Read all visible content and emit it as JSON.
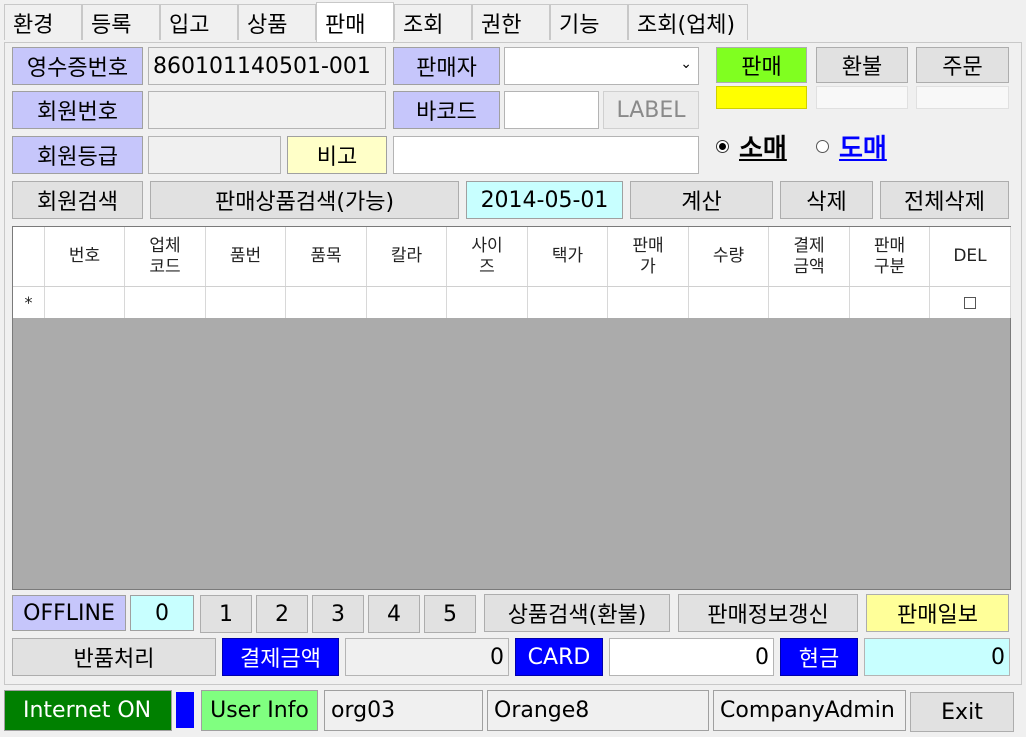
{
  "tabs": [
    "환경",
    "등록",
    "입고",
    "상품",
    "판매",
    "조회",
    "권한",
    "기능",
    "조회(업체)"
  ],
  "form": {
    "receipt_label": "영수증번호",
    "receipt_value": "860101140501-001",
    "seller_label": "판매자",
    "seller_value": "",
    "member_no_label": "회원번호",
    "member_no_value": "",
    "barcode_label": "바코드",
    "barcode_value": "",
    "label_button": "LABEL",
    "member_grade_label": "회원등급",
    "member_grade_value": "",
    "note_label": "비고",
    "note_value": ""
  },
  "mode": {
    "sale": "판매",
    "refund": "환불",
    "order": "주문"
  },
  "sale_type": {
    "retail": "소매",
    "wholesale": "도매",
    "selected": "retail"
  },
  "actions": {
    "member_search": "회원검색",
    "product_search": "판매상품검색(가능)",
    "date": "2014-05-01",
    "calculate": "계산",
    "delete": "삭제",
    "delete_all": "전체삭제"
  },
  "grid": {
    "columns": [
      "",
      "번호",
      "업체\n코드",
      "품번",
      "품목",
      "칼라",
      "사이\n즈",
      "택가",
      "판매\n가",
      "수량",
      "결제\n금액",
      "판매\n구분",
      "DEL"
    ],
    "new_row_marker": "*"
  },
  "bottom": {
    "offline": "OFFLINE",
    "count": "0",
    "pages": [
      "1",
      "2",
      "3",
      "4",
      "5"
    ],
    "refund_search": "상품검색(환불)",
    "refresh_sales": "판매정보갱신",
    "daily_report": "판매일보",
    "return_process": "반품처리",
    "payment_label": "결제금액",
    "payment_value": "0",
    "card_label": "CARD",
    "card_value": "0",
    "cash_label": "현금",
    "cash_value": "0"
  },
  "statusbar": {
    "internet": "Internet ON",
    "user_info": "User Info",
    "org": "org03",
    "store": "Orange8",
    "role": "CompanyAdmin",
    "exit": "Exit"
  },
  "colors": {
    "label_bg": "#c6c6fb",
    "sale_active": "#80ff20",
    "sale_indicator": "#ffff00",
    "note_bg": "#ffffc8",
    "date_bg": "#c8ffff",
    "accent_blue": "#0000ff",
    "internet_green": "#008000",
    "user_info_green": "#80ff80"
  }
}
